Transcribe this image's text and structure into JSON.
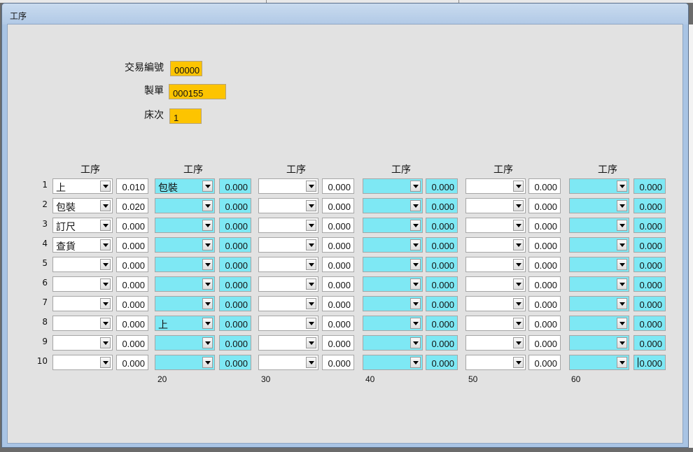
{
  "window": {
    "title": "工序"
  },
  "header": {
    "trade_no": {
      "label": "交易編號",
      "value": "00000"
    },
    "order": {
      "label": "製單",
      "value": "000155"
    },
    "bed": {
      "label": "床次",
      "value": "1"
    }
  },
  "column_headers": [
    "工序",
    "工序",
    "工序",
    "工序",
    "工序",
    "工序"
  ],
  "row_numbers": [
    "1",
    "2",
    "3",
    "4",
    "5",
    "6",
    "7",
    "8",
    "9",
    "10"
  ],
  "footers": [
    "20",
    "30",
    "40",
    "50",
    "60"
  ],
  "grid": [
    {
      "highlight": false,
      "cells": [
        {
          "process": "上",
          "value": "0.010"
        },
        {
          "process": "包裝",
          "value": "0.020"
        },
        {
          "process": "訂尺",
          "value": "0.000"
        },
        {
          "process": "查貨",
          "value": "0.000"
        },
        {
          "process": "",
          "value": "0.000"
        },
        {
          "process": "",
          "value": "0.000"
        },
        {
          "process": "",
          "value": "0.000"
        },
        {
          "process": "",
          "value": "0.000"
        },
        {
          "process": "",
          "value": "0.000"
        },
        {
          "process": "",
          "value": "0.000"
        }
      ]
    },
    {
      "highlight": true,
      "cells": [
        {
          "process": "包裝",
          "value": "0.000"
        },
        {
          "process": "",
          "value": "0.000"
        },
        {
          "process": "",
          "value": "0.000"
        },
        {
          "process": "",
          "value": "0.000"
        },
        {
          "process": "",
          "value": "0.000"
        },
        {
          "process": "",
          "value": "0.000"
        },
        {
          "process": "",
          "value": "0.000"
        },
        {
          "process": "上",
          "value": "0.000"
        },
        {
          "process": "",
          "value": "0.000"
        },
        {
          "process": "",
          "value": "0.000"
        }
      ]
    },
    {
      "highlight": false,
      "cells": [
        {
          "process": "",
          "value": "0.000"
        },
        {
          "process": "",
          "value": "0.000"
        },
        {
          "process": "",
          "value": "0.000"
        },
        {
          "process": "",
          "value": "0.000"
        },
        {
          "process": "",
          "value": "0.000"
        },
        {
          "process": "",
          "value": "0.000"
        },
        {
          "process": "",
          "value": "0.000"
        },
        {
          "process": "",
          "value": "0.000"
        },
        {
          "process": "",
          "value": "0.000"
        },
        {
          "process": "",
          "value": "0.000"
        }
      ]
    },
    {
      "highlight": true,
      "cells": [
        {
          "process": "",
          "value": "0.000"
        },
        {
          "process": "",
          "value": "0.000"
        },
        {
          "process": "",
          "value": "0.000"
        },
        {
          "process": "",
          "value": "0.000"
        },
        {
          "process": "",
          "value": "0.000"
        },
        {
          "process": "",
          "value": "0.000"
        },
        {
          "process": "",
          "value": "0.000"
        },
        {
          "process": "",
          "value": "0.000"
        },
        {
          "process": "",
          "value": "0.000"
        },
        {
          "process": "",
          "value": "0.000"
        }
      ]
    },
    {
      "highlight": false,
      "cells": [
        {
          "process": "",
          "value": "0.000"
        },
        {
          "process": "",
          "value": "0.000"
        },
        {
          "process": "",
          "value": "0.000"
        },
        {
          "process": "",
          "value": "0.000"
        },
        {
          "process": "",
          "value": "0.000"
        },
        {
          "process": "",
          "value": "0.000"
        },
        {
          "process": "",
          "value": "0.000"
        },
        {
          "process": "",
          "value": "0.000"
        },
        {
          "process": "",
          "value": "0.000"
        },
        {
          "process": "",
          "value": "0.000"
        }
      ]
    },
    {
      "highlight": true,
      "cells": [
        {
          "process": "",
          "value": "0.000"
        },
        {
          "process": "",
          "value": "0.000"
        },
        {
          "process": "",
          "value": "0.000"
        },
        {
          "process": "",
          "value": "0.000"
        },
        {
          "process": "",
          "value": "0.000"
        },
        {
          "process": "",
          "value": "0.000"
        },
        {
          "process": "",
          "value": "0.000"
        },
        {
          "process": "",
          "value": "0.000"
        },
        {
          "process": "",
          "value": "0.000"
        },
        {
          "process": "",
          "value": "0.000"
        }
      ]
    }
  ]
}
